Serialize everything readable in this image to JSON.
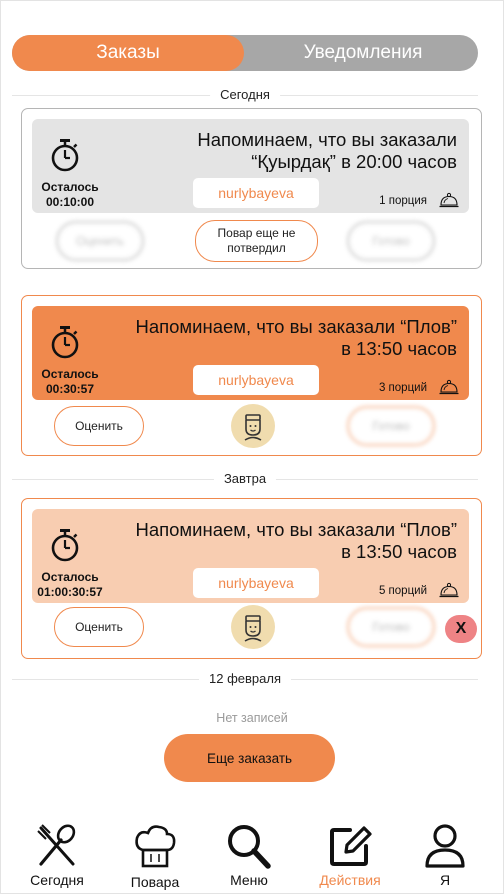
{
  "tabs": {
    "orders": "Заказы",
    "notifications": "Уведомления"
  },
  "sections": {
    "today": "Сегодня",
    "tomorrow": "Завтра",
    "feb12": "12 февраля"
  },
  "cards": [
    {
      "line1": "Напоминаем, что вы заказали",
      "line2": "“Қуырдақ” в 20:00 часов",
      "remaining_label": "Осталось",
      "remaining_time": "00:10:00",
      "user": "nurlybayeva",
      "portions": "1 порция",
      "rate": "Оценить",
      "status": "Повар еще не потвердил",
      "ready": "Готово"
    },
    {
      "line1": "Напоминаем, что вы заказали “Плов”",
      "line2": "в 13:50 часов",
      "remaining_label": "Осталось",
      "remaining_time": "00:30:57",
      "user": "nurlybayeva",
      "portions": "3 порций",
      "rate": "Оценить",
      "ready": "Готово"
    },
    {
      "line1": "Напоминаем, что вы заказали “Плов”",
      "line2": "в 13:50 часов",
      "remaining_label": "Осталось",
      "remaining_time": "01:00:30:57",
      "user": "nurlybayeva",
      "portions": "5 порций",
      "rate": "Оценить",
      "ready": "Готово",
      "cancel": "X"
    }
  ],
  "empty": "Нет записей",
  "order_more": "Еще заказать",
  "nav": {
    "today": "Сегодня",
    "cooks": "Повара",
    "menu": "Меню",
    "actions": "Действия",
    "me": "Я"
  },
  "colors": {
    "accent": "#f0894d",
    "tab_inactive": "#a7a7a7",
    "peach": "#f8cdb1",
    "gray_card": "#e4e4e4",
    "cancel": "#ee8385"
  }
}
